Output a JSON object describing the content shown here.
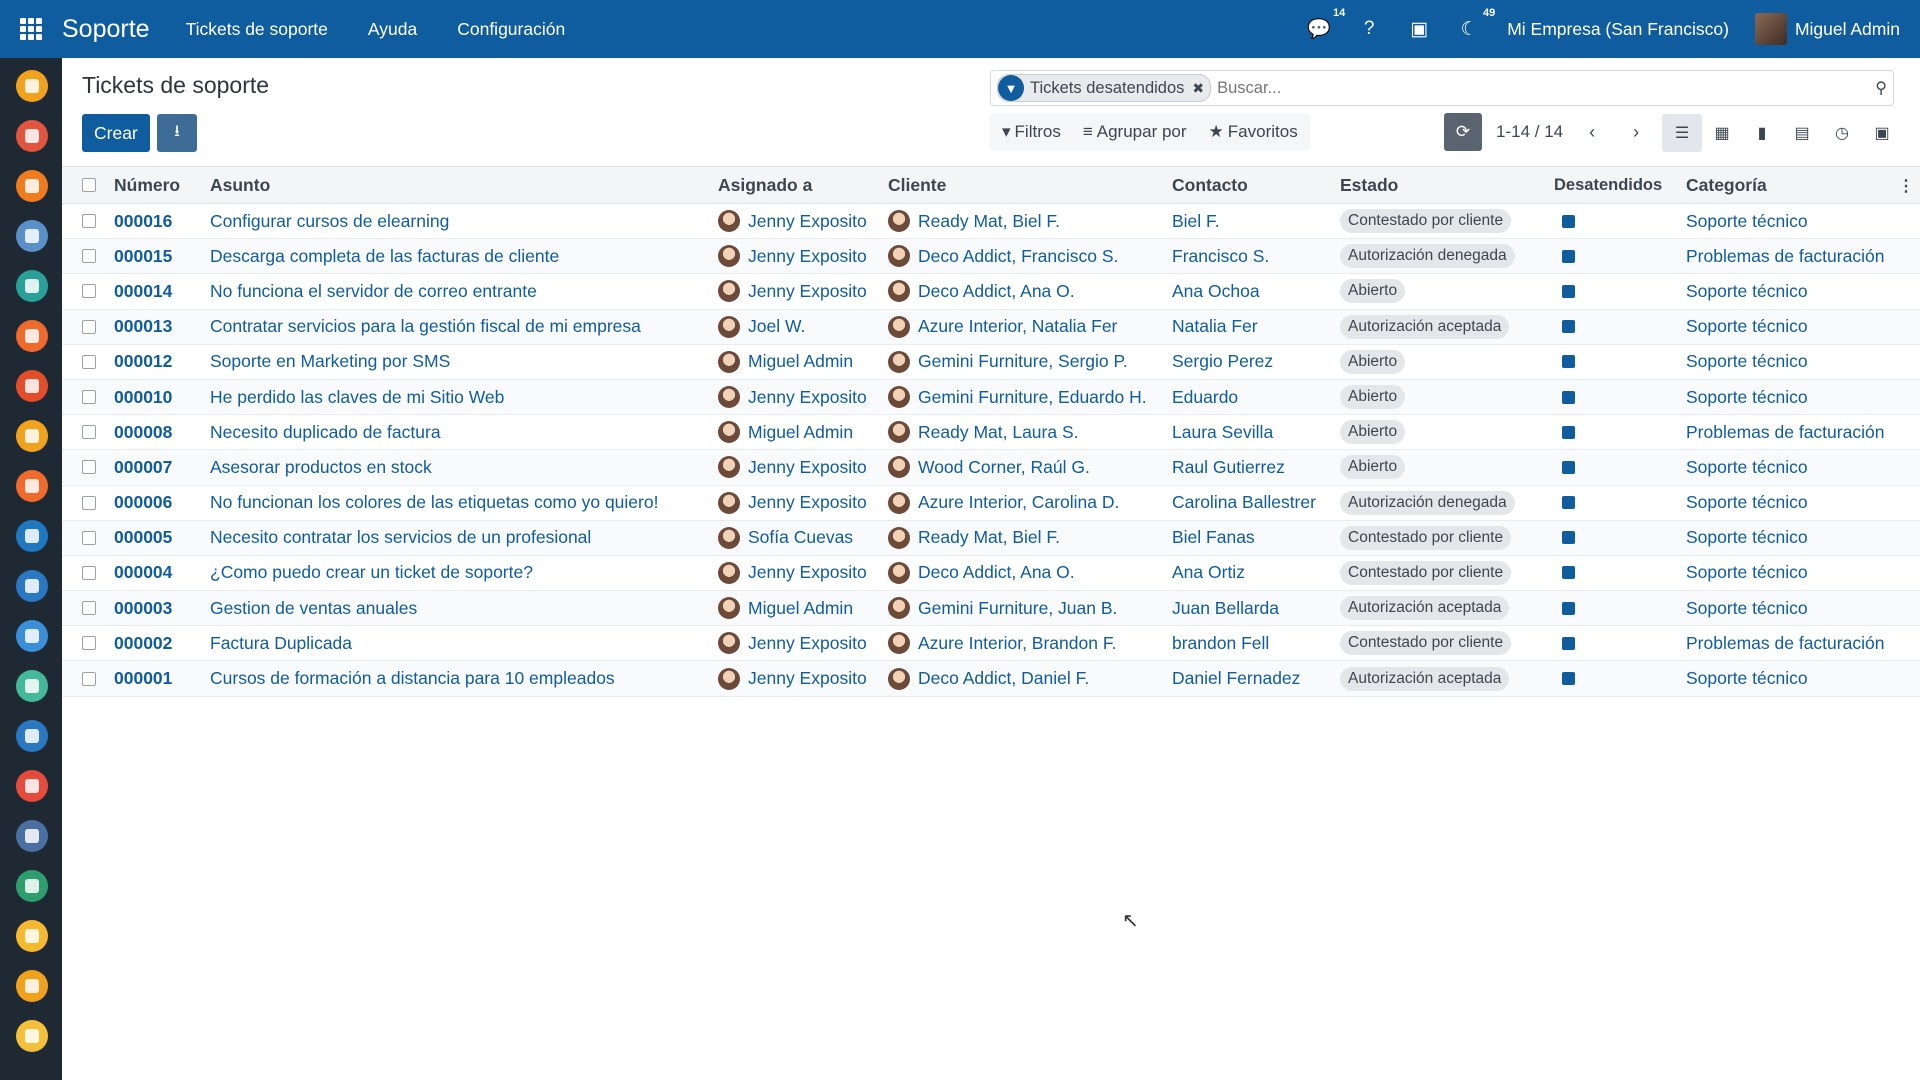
{
  "navbar": {
    "app_name": "Soporte",
    "menu": [
      "Tickets de soporte",
      "Ayuda",
      "Configuración"
    ],
    "chat_badge": "14",
    "activity_badge": "49",
    "company": "Mi Empresa (San Francisco)",
    "user": "Miguel Admin"
  },
  "control_panel": {
    "title": "Tickets de soporte",
    "create_label": "Crear",
    "facet_label": "Tickets desatendidos",
    "search_placeholder": "Buscar...",
    "filters_label": "Filtros",
    "groupby_label": "Agrupar por",
    "favorites_label": "Favoritos",
    "pager": "1-14 / 14"
  },
  "table": {
    "headers": {
      "number": "Número",
      "subject": "Asunto",
      "assigned": "Asignado a",
      "client": "Cliente",
      "contact": "Contacto",
      "state": "Estado",
      "unattended": "Desatendidos",
      "category": "Categoría"
    },
    "rows": [
      {
        "number": "000016",
        "subject": "Configurar cursos de elearning",
        "assigned": "Jenny Exposito",
        "client": "Ready Mat, Biel F.",
        "contact": "Biel F.",
        "state": "Contestado por cliente",
        "category": "Soporte técnico"
      },
      {
        "number": "000015",
        "subject": "Descarga completa de las facturas de cliente",
        "assigned": "Jenny Exposito",
        "client": "Deco Addict, Francisco S.",
        "contact": "Francisco S.",
        "state": "Autorización denegada",
        "category": "Problemas de facturación"
      },
      {
        "number": "000014",
        "subject": "No funciona el servidor de correo entrante",
        "assigned": "Jenny Exposito",
        "client": "Deco Addict, Ana O.",
        "contact": "Ana Ochoa",
        "state": "Abierto",
        "category": "Soporte técnico"
      },
      {
        "number": "000013",
        "subject": "Contratar servicios para la gestión fiscal de mi empresa",
        "assigned": "Joel W.",
        "client": "Azure Interior, Natalia Fer",
        "contact": "Natalia Fer",
        "state": "Autorización aceptada",
        "category": "Soporte técnico"
      },
      {
        "number": "000012",
        "subject": "Soporte en Marketing por SMS",
        "assigned": "Miguel Admin",
        "client": "Gemini Furniture, Sergio P.",
        "contact": "Sergio Perez",
        "state": "Abierto",
        "category": "Soporte técnico"
      },
      {
        "number": "000010",
        "subject": "He perdido las claves de mi Sitio Web",
        "assigned": "Jenny Exposito",
        "client": "Gemini Furniture, Eduardo H.",
        "contact": "Eduardo",
        "state": "Abierto",
        "category": "Soporte técnico"
      },
      {
        "number": "000008",
        "subject": "Necesito duplicado de factura",
        "assigned": "Miguel Admin",
        "client": "Ready Mat, Laura S.",
        "contact": "Laura Sevilla",
        "state": "Abierto",
        "category": "Problemas de facturación"
      },
      {
        "number": "000007",
        "subject": "Asesorar productos en stock",
        "assigned": "Jenny Exposito",
        "client": "Wood Corner, Raúl G.",
        "contact": "Raul Gutierrez",
        "state": "Abierto",
        "category": "Soporte técnico"
      },
      {
        "number": "000006",
        "subject": "No funcionan los colores de las etiquetas como yo quiero!",
        "assigned": "Jenny Exposito",
        "client": "Azure Interior, Carolina D.",
        "contact": "Carolina Ballestrer",
        "state": "Autorización denegada",
        "category": "Soporte técnico"
      },
      {
        "number": "000005",
        "subject": "Necesito contratar los servicios de un profesional",
        "assigned": "Sofía Cuevas",
        "client": "Ready Mat, Biel F.",
        "contact": "Biel Fanas",
        "state": "Contestado por cliente",
        "category": "Soporte técnico"
      },
      {
        "number": "000004",
        "subject": "¿Como puedo crear un ticket de soporte?",
        "assigned": "Jenny Exposito",
        "client": "Deco Addict, Ana O.",
        "contact": "Ana Ortiz",
        "state": "Contestado por cliente",
        "category": "Soporte técnico"
      },
      {
        "number": "000003",
        "subject": "Gestion de ventas anuales",
        "assigned": "Miguel Admin",
        "client": "Gemini Furniture, Juan B.",
        "contact": "Juan Bellarda",
        "state": "Autorización aceptada",
        "category": "Soporte técnico"
      },
      {
        "number": "000002",
        "subject": "Factura Duplicada",
        "assigned": "Jenny Exposito",
        "client": "Azure Interior, Brandon F.",
        "contact": "brandon Fell",
        "state": "Contestado por cliente",
        "category": "Problemas de facturación"
      },
      {
        "number": "000001",
        "subject": "Cursos de formación a distancia para 10 empleados",
        "assigned": "Jenny Exposito",
        "client": "Deco Addict, Daniel F.",
        "contact": "Daniel Fernadez",
        "state": "Autorización aceptada",
        "category": "Soporte técnico"
      }
    ]
  },
  "sidebar_apps": [
    "#f0a21c",
    "#e2543e",
    "#f07c1e",
    "#5b8fc7",
    "#2aa198",
    "#ef6a2b",
    "#e34d2a",
    "#f0a21c",
    "#ef6a2b",
    "#1f78c1",
    "#2a78c2",
    "#3a8fd8",
    "#44b89a",
    "#2a78c2",
    "#e44b3b",
    "#4b6fa0",
    "#2f9e6e",
    "#f5b82e",
    "#f0a21c",
    "#f4c03a"
  ]
}
